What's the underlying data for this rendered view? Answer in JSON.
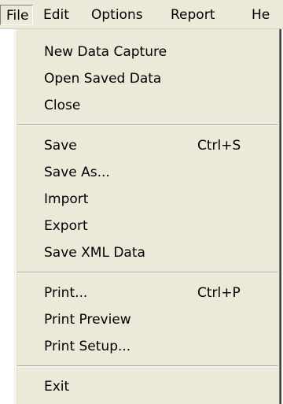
{
  "menubar": {
    "items": [
      {
        "label": "File"
      },
      {
        "label": "Edit"
      },
      {
        "label": "Options"
      },
      {
        "label": "Report"
      },
      {
        "label": "He"
      }
    ]
  },
  "file_menu": {
    "items": [
      {
        "label": "New Data Capture",
        "shortcut": ""
      },
      {
        "label": "Open Saved Data",
        "shortcut": ""
      },
      {
        "label": "Close",
        "shortcut": ""
      },
      {
        "label": "Save",
        "shortcut": "Ctrl+S"
      },
      {
        "label": "Save As...",
        "shortcut": ""
      },
      {
        "label": "Import",
        "shortcut": ""
      },
      {
        "label": "Export",
        "shortcut": ""
      },
      {
        "label": "Save XML Data",
        "shortcut": ""
      },
      {
        "label": "Print...",
        "shortcut": "Ctrl+P"
      },
      {
        "label": "Print Preview",
        "shortcut": ""
      },
      {
        "label": "Print Setup...",
        "shortcut": ""
      },
      {
        "label": "Exit",
        "shortcut": ""
      }
    ]
  },
  "colors": {
    "menu_background": "#ece9d8",
    "text": "#000000"
  }
}
